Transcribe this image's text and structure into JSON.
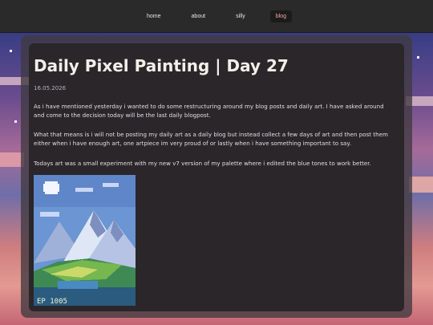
{
  "nav": {
    "items": [
      {
        "label": "home"
      },
      {
        "label": "about"
      },
      {
        "label": "silly"
      },
      {
        "label": "blog",
        "active": true
      }
    ]
  },
  "post": {
    "title": "Daily Pixel Painting | Day 27",
    "date": "16.05.2026",
    "paragraphs": [
      "As i have mentioned yesterday i wanted to do some restructuring around my blog posts and daily art. I have asked around and come to the decision today will be the last daily blogpost.",
      "What that means is i will not be posting my daily art as a daily blog but instead collect a few days of art and then post them either when i have enough art, one artpiece im very proud of or lastly when i have something important to say.",
      "Todays art was a small experiment with my new v7 version of my palette where i edited the blue tones to work better."
    ],
    "artwork_text": "EP 1005"
  },
  "colors": {
    "topbar": "#2a2a2b",
    "card": "#2a262a",
    "active_nav_text": "#f2a8a6"
  }
}
